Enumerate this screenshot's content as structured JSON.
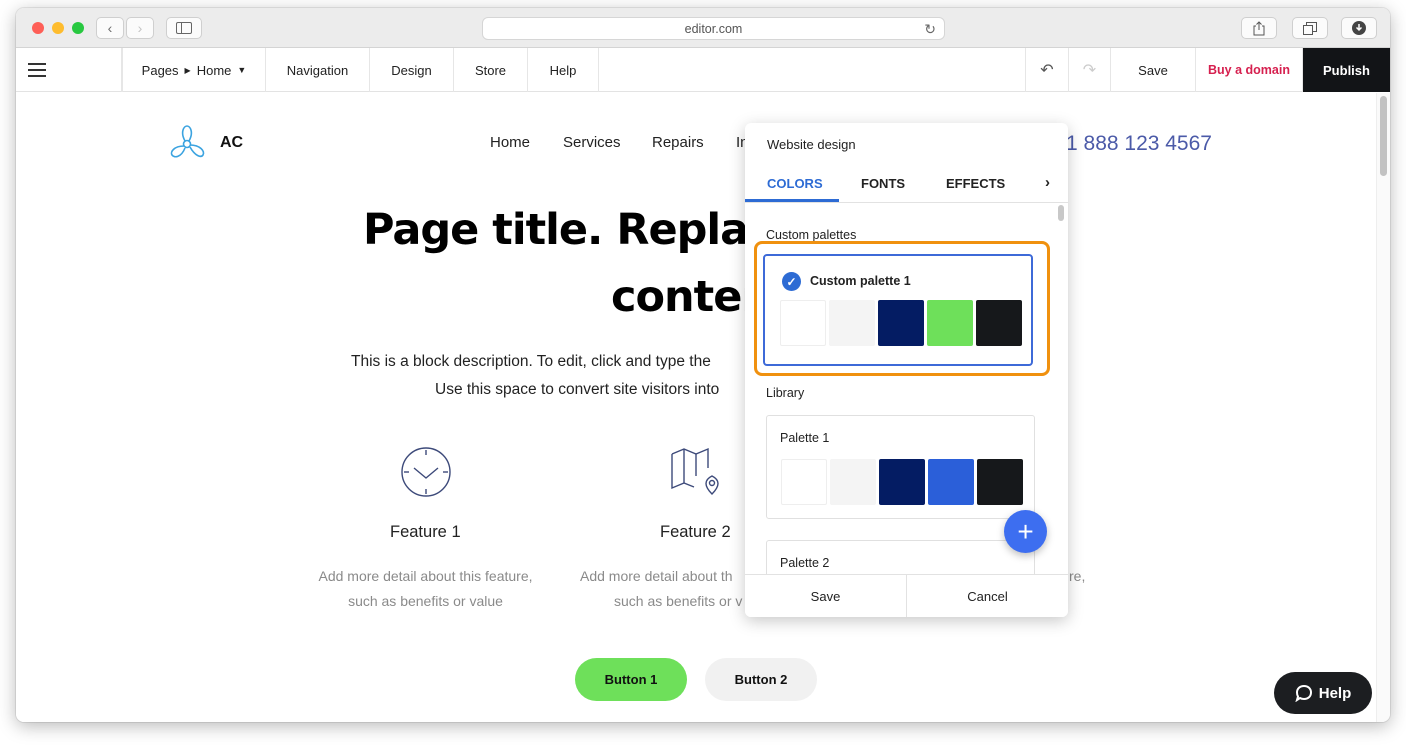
{
  "browser": {
    "url": "editor.com",
    "traffic_light_colors": {
      "close": "#fe5f57",
      "minimize": "#febc2e",
      "maximize": "#28c840"
    }
  },
  "toolbar": {
    "pages_label": "Pages",
    "page_label": "Home",
    "navigation_label": "Navigation",
    "design_label": "Design",
    "store_label": "Store",
    "help_label": "Help",
    "save_label": "Save",
    "buy_domain_label": "Buy a domain",
    "publish_label": "Publish",
    "buy_domain_color": "#d6204f",
    "publish_bg": "#121417"
  },
  "site": {
    "logo_text": "AC",
    "nav": [
      "Home",
      "Services",
      "Repairs",
      "In"
    ],
    "phone": "1 888 123 4567",
    "title_line1": "Page title. Replac",
    "title_line2": "conter",
    "desc_line1": "This is a block description. To edit, click and type the",
    "desc_line2": "Use this space to convert site visitors into",
    "features": [
      {
        "title": "Feature 1",
        "desc_line1": "Add more detail about this feature,",
        "desc_line2": "such as benefits or value"
      },
      {
        "title": "Feature 2",
        "desc_line1": "Add more detail about th",
        "desc_line2": "such as benefits or v"
      }
    ],
    "feature3_fragment": "re,",
    "button1": "Button 1",
    "button2": "Button 2",
    "help_button": "Help",
    "accent_color": "#6ee05a"
  },
  "design_panel": {
    "title": "Website design",
    "tabs": [
      "COLORS",
      "FONTS",
      "EFFECTS"
    ],
    "active_tab": "COLORS",
    "custom_section": "Custom palettes",
    "custom_palette": {
      "name": "Custom palette 1",
      "selected": true,
      "colors": [
        "#ffffff",
        "#f4f4f4",
        "#041c63",
        "#6ee05a",
        "#16181b"
      ]
    },
    "library_section": "Library",
    "palettes": [
      {
        "name": "Palette 1",
        "colors": [
          "#ffffff",
          "#f4f4f4",
          "#041c63",
          "#2b5fd9",
          "#16181b"
        ]
      },
      {
        "name": "Palette 2"
      }
    ],
    "save_label": "Save",
    "cancel_label": "Cancel",
    "highlight_color": "#f0910f"
  }
}
